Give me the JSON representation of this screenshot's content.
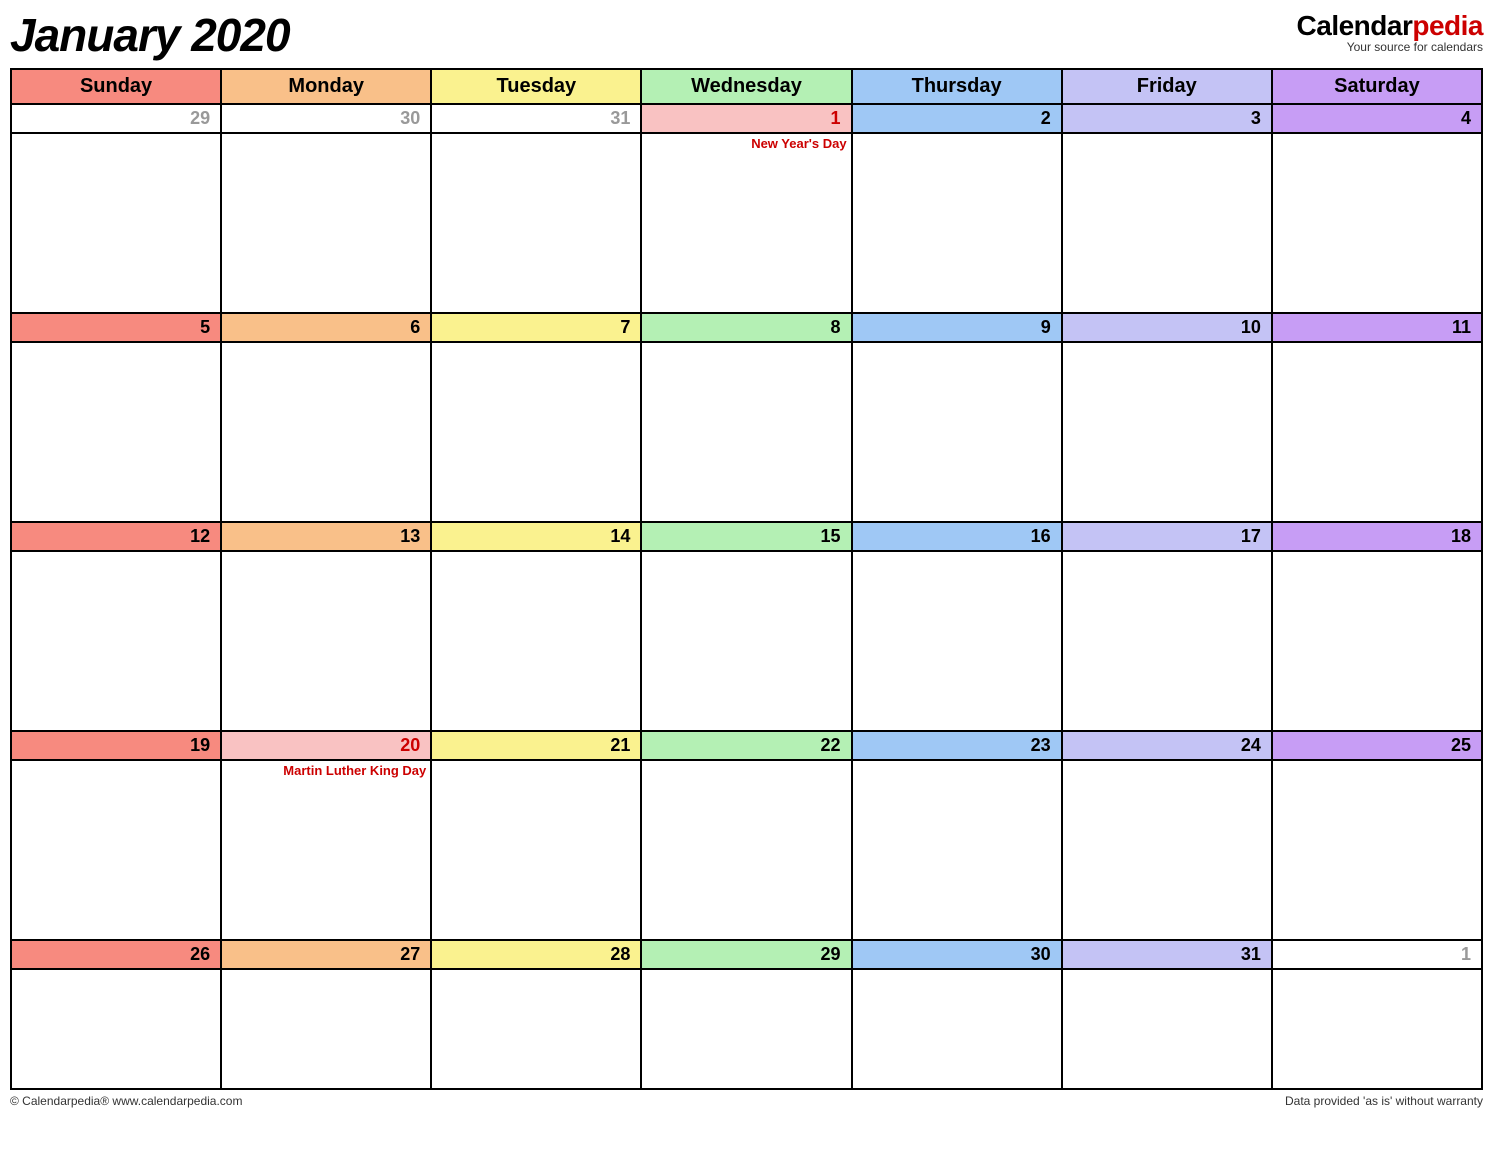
{
  "title": "January 2020",
  "logo": {
    "part1": "Calendar",
    "part2": "pedia",
    "tagline": "Your source for calendars"
  },
  "days": [
    "Sunday",
    "Monday",
    "Tuesday",
    "Wednesday",
    "Thursday",
    "Friday",
    "Saturday"
  ],
  "weeks": [
    [
      {
        "n": "29",
        "outside": true
      },
      {
        "n": "30",
        "outside": true
      },
      {
        "n": "31",
        "outside": true
      },
      {
        "n": "1",
        "holiday": true,
        "event": "New Year's Day"
      },
      {
        "n": "2"
      },
      {
        "n": "3"
      },
      {
        "n": "4"
      }
    ],
    [
      {
        "n": "5"
      },
      {
        "n": "6"
      },
      {
        "n": "7"
      },
      {
        "n": "8"
      },
      {
        "n": "9"
      },
      {
        "n": "10"
      },
      {
        "n": "11"
      }
    ],
    [
      {
        "n": "12"
      },
      {
        "n": "13"
      },
      {
        "n": "14"
      },
      {
        "n": "15"
      },
      {
        "n": "16"
      },
      {
        "n": "17"
      },
      {
        "n": "18"
      }
    ],
    [
      {
        "n": "19"
      },
      {
        "n": "20",
        "holiday": true,
        "event": "Martin Luther King Day"
      },
      {
        "n": "21"
      },
      {
        "n": "22"
      },
      {
        "n": "23"
      },
      {
        "n": "24"
      },
      {
        "n": "25"
      }
    ],
    [
      {
        "n": "26"
      },
      {
        "n": "27"
      },
      {
        "n": "28"
      },
      {
        "n": "29"
      },
      {
        "n": "30"
      },
      {
        "n": "31"
      },
      {
        "n": "1",
        "outside": true
      }
    ]
  ],
  "footer": {
    "left": "© Calendarpedia®   www.calendarpedia.com",
    "right": "Data provided 'as is' without warranty"
  },
  "colors": {
    "sun": "#f78a7f",
    "mon": "#f9c089",
    "tue": "#faf28f",
    "wed": "#b4f0b4",
    "thu": "#9fc8f5",
    "fri": "#c4c3f5",
    "sat": "#c79df5",
    "holiday": "#f9c2c2"
  }
}
